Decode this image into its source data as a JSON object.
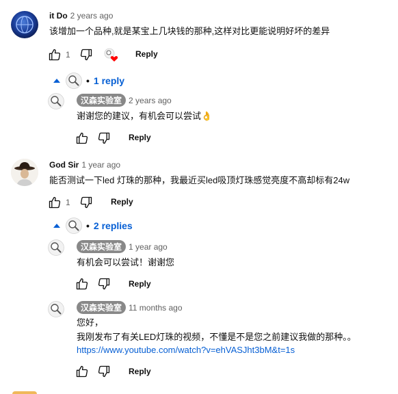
{
  "comments": [
    {
      "author": "it Do",
      "time": "2 years ago",
      "text": "该增加一个品种,就是某宝上几块钱的那种,这样对比更能说明好坏的差异",
      "likes": "1",
      "reply_label": "Reply",
      "replies_toggle": "1 reply",
      "replies": [
        {
          "author": "汉森实验室",
          "time": "2 years ago",
          "text": "谢谢您的建议，有机会可以尝试👌",
          "reply_label": "Reply"
        }
      ]
    },
    {
      "author": "God Sir",
      "time": "1 year ago",
      "text": "能否测试一下led 灯珠的那种，我最近买led吸顶灯珠感觉亮度不高却标有24w",
      "likes": "1",
      "reply_label": "Reply",
      "replies_toggle": "2 replies",
      "replies": [
        {
          "author": "汉森实验室",
          "time": "1 year ago",
          "text": "有机会可以尝试！谢谢您",
          "reply_label": "Reply"
        },
        {
          "author": "汉森实验室",
          "time": "11 months ago",
          "text_lines": [
            "您好，",
            "我刚发布了有关LED灯珠的视频，不懂是不是您之前建议我做的那种。。"
          ],
          "link": "https://www.youtube.com/watch?v=ehVASJht3bM&t=1s",
          "reply_label": "Reply"
        }
      ]
    }
  ],
  "colors": {
    "link": "#065fd4",
    "meta": "#606060",
    "chip": "#888888",
    "heart": "#ff0000"
  }
}
